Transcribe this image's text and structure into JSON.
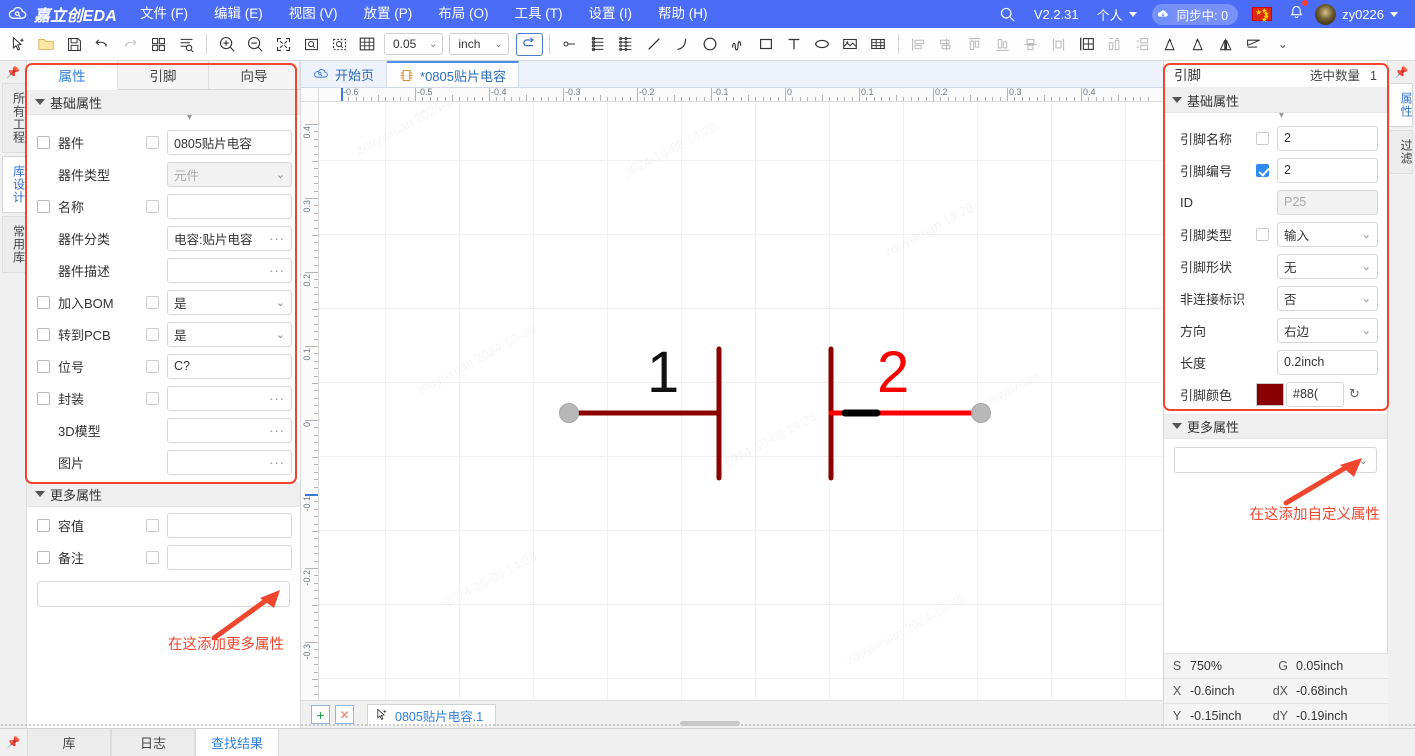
{
  "titlebar": {
    "brand": "嘉立创EDA",
    "menus": [
      {
        "label": "文件 (F)",
        "name": "menu-file"
      },
      {
        "label": "编辑 (E)",
        "name": "menu-edit"
      },
      {
        "label": "视图 (V)",
        "name": "menu-view"
      },
      {
        "label": "放置 (P)",
        "name": "menu-place"
      },
      {
        "label": "布局 (O)",
        "name": "menu-layout"
      },
      {
        "label": "工具 (T)",
        "name": "menu-tools"
      },
      {
        "label": "设置 (I)",
        "name": "menu-settings"
      },
      {
        "label": "帮助 (H)",
        "name": "menu-help"
      }
    ],
    "version": "V2.2.31",
    "account_mode": "个人",
    "sync_status": "同步中: 0",
    "username": "zy0226",
    "search_icon": "search-icon",
    "flag_icon": "china-flag-icon",
    "bell_icon": "notification-bell-icon"
  },
  "toolbar": {
    "grid_value": "0.05",
    "unit_value": "inch",
    "icons": [
      "pointer-select-icon",
      "open-folder-icon",
      "save-icon",
      "undo-icon",
      "redo-icon",
      "grid-view-icon",
      "list-search-icon",
      "zoom-in-icon",
      "zoom-out-icon",
      "fit-screen-icon",
      "zoom-region-icon",
      "zoom-selection-icon",
      "grid-toggle-icon",
      "pin-icon",
      "bus-icon",
      "bus-entry-icon",
      "line-icon",
      "arc-icon",
      "circle-icon",
      "polyline-icon",
      "rectangle-icon",
      "text-icon",
      "ellipse-icon",
      "image-icon",
      "table-icon",
      "align-left-icon",
      "align-center-h-icon",
      "align-top-icon",
      "align-bottom-icon",
      "align-middle-v-icon",
      "distribute-h-icon",
      "grid-align-icon",
      "distribute-v-icon",
      "spacing-icon",
      "rotate-ccw-icon",
      "rotate-cw-icon",
      "flip-horizontal-icon",
      "flip-vertical-icon",
      "chevron-down-icon",
      "undo-arrow-icon"
    ]
  },
  "left_rail": {
    "pin_icon": "pin-icon",
    "tabs": [
      {
        "label": "所有工程",
        "selected": false,
        "name": "rail-tab-all-projects"
      },
      {
        "label": "库设计",
        "selected": true,
        "name": "rail-tab-library-design"
      },
      {
        "label": "常用库",
        "selected": false,
        "name": "rail-tab-common-library"
      }
    ]
  },
  "right_rail": {
    "pin_icon": "pin-icon",
    "tabs": [
      {
        "label": "属性",
        "selected": true,
        "name": "rail-tab-properties"
      },
      {
        "label": "过滤",
        "selected": false,
        "name": "rail-tab-filter"
      }
    ]
  },
  "left_panel": {
    "tabs": [
      {
        "label": "属性",
        "selected": true
      },
      {
        "label": "引脚",
        "selected": false
      },
      {
        "label": "向导",
        "selected": false
      }
    ],
    "basic_section": "基础属性",
    "more_section": "更多属性",
    "basic_rows": [
      {
        "label": "器件",
        "cb1": true,
        "cb2": true,
        "value": "0805贴片电容",
        "kind": "text",
        "readonly": false
      },
      {
        "label": "器件类型",
        "cb1": false,
        "cb2": false,
        "value": "元件",
        "kind": "select",
        "readonly": true
      },
      {
        "label": "名称",
        "cb1": true,
        "cb2": true,
        "value": "",
        "kind": "text",
        "readonly": false
      },
      {
        "label": "器件分类",
        "cb1": false,
        "cb2": false,
        "value": "电容:贴片电容",
        "kind": "dots",
        "readonly": false
      },
      {
        "label": "器件描述",
        "cb1": false,
        "cb2": false,
        "value": "",
        "kind": "dots",
        "readonly": false
      },
      {
        "label": "加入BOM",
        "cb1": true,
        "cb2": true,
        "value": "是",
        "kind": "select",
        "readonly": false
      },
      {
        "label": "转到PCB",
        "cb1": true,
        "cb2": true,
        "value": "是",
        "kind": "select",
        "readonly": false
      },
      {
        "label": "位号",
        "cb1": true,
        "cb2": true,
        "value": "C?",
        "kind": "text",
        "readonly": false
      },
      {
        "label": "封装",
        "cb1": true,
        "cb2": true,
        "value": "",
        "kind": "dots",
        "readonly": false
      },
      {
        "label": "3D模型",
        "cb1": false,
        "cb2": false,
        "value": "",
        "kind": "dots",
        "readonly": false
      },
      {
        "label": "图片",
        "cb1": false,
        "cb2": false,
        "value": "",
        "kind": "dots",
        "readonly": false
      }
    ],
    "more_rows": [
      {
        "label": "容值",
        "cb1": true,
        "cb2": true,
        "value": "",
        "kind": "text",
        "readonly": false
      },
      {
        "label": "备注",
        "cb1": true,
        "cb2": true,
        "value": "",
        "kind": "text",
        "readonly": false
      }
    ],
    "annotation": "在这添加更多属性"
  },
  "doc_tabs": [
    {
      "label": "开始页",
      "icon": "cloud-home-icon",
      "selected": false
    },
    {
      "label": "*0805贴片电容",
      "icon": "component-chip-icon",
      "selected": true
    }
  ],
  "canvas": {
    "ruler_h_labels": [
      "-0.6",
      "-0.5",
      "-0.4",
      "-0.3",
      "-0.2",
      "-0.1",
      "0",
      "0.1",
      "0.2",
      "0.3",
      "0.4"
    ],
    "ruler_v_labels": [
      "0.4",
      "0.3",
      "0.2",
      "0.1",
      "0",
      "-0.1",
      "-0.2",
      "-0.3"
    ],
    "pin1_label": "1",
    "pin2_label": "2",
    "pin1_color": "#8b0000",
    "pin2_color": "#ff0000",
    "watermark": "zouyuxuan 2024-10-08 14:28"
  },
  "bottom_strip": {
    "add_icon": "add-sheet-icon",
    "close_icon": "close-sheet-icon",
    "sheet_tab": "0805贴片电容.1",
    "sheet_icon": "pointer-select-icon"
  },
  "right_panel": {
    "title": "引脚",
    "count_label": "选中数量",
    "count_value": "1",
    "basic_section": "基础属性",
    "more_section": "更多属性",
    "rows": [
      {
        "label": "引脚名称",
        "cb": false,
        "has_cb": true,
        "value": "2",
        "kind": "text",
        "readonly": false
      },
      {
        "label": "引脚编号",
        "cb": true,
        "has_cb": true,
        "value": "2",
        "kind": "text",
        "readonly": false
      },
      {
        "label": "ID",
        "cb": false,
        "has_cb": false,
        "value": "P25",
        "kind": "text",
        "readonly": true
      },
      {
        "label": "引脚类型",
        "cb": false,
        "has_cb": true,
        "value": "输入",
        "kind": "select",
        "readonly": false
      },
      {
        "label": "引脚形状",
        "cb": false,
        "has_cb": false,
        "value": "无",
        "kind": "select",
        "readonly": false
      },
      {
        "label": "非连接标识",
        "cb": false,
        "has_cb": false,
        "value": "否",
        "kind": "select",
        "readonly": false
      },
      {
        "label": "方向",
        "cb": false,
        "has_cb": false,
        "value": "右边",
        "kind": "select",
        "readonly": false
      },
      {
        "label": "长度",
        "cb": false,
        "has_cb": false,
        "value": "0.2inch",
        "kind": "text",
        "readonly": false
      }
    ],
    "color_row": {
      "label": "引脚颜色",
      "swatch": "#880000",
      "value": "#88(",
      "reset_icon": "reset-icon"
    },
    "annotation": "在这添加自定义属性",
    "status": [
      {
        "k": "S",
        "v": "750%",
        "k2": "G",
        "v2": "0.05inch"
      },
      {
        "k": "X",
        "v": "-0.6inch",
        "k2": "dX",
        "v2": "-0.68inch"
      },
      {
        "k": "Y",
        "v": "-0.15inch",
        "k2": "dY",
        "v2": "-0.19inch"
      }
    ]
  },
  "bottom_bar": {
    "pin_icon": "pin-icon",
    "tabs": [
      {
        "label": "库",
        "selected": false
      },
      {
        "label": "日志",
        "selected": false
      },
      {
        "label": "查找结果",
        "selected": true
      }
    ]
  }
}
